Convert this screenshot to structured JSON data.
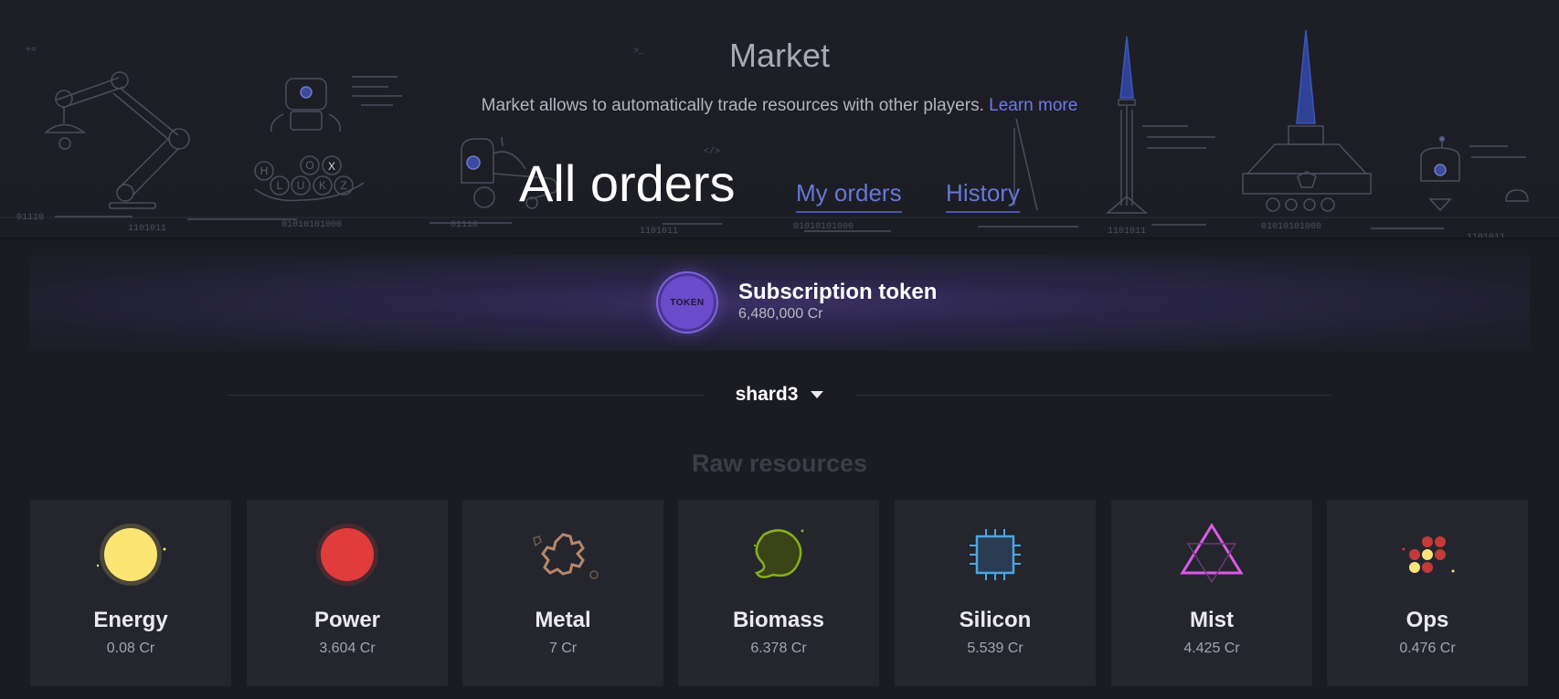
{
  "header": {
    "title": "Market",
    "subtitle": "Market allows to automatically trade resources with other players.",
    "learn_more": "Learn more",
    "tabs": [
      {
        "label": "All orders",
        "active": true
      },
      {
        "label": "My orders",
        "active": false
      },
      {
        "label": "History",
        "active": false
      }
    ],
    "decor_text": {
      "binary_1": "01110",
      "binary_2": "1101011",
      "binary_3": "01010101000",
      "binary_4": "01110",
      "binary_5": "1101011",
      "binary_6": "01010101000",
      "binary_7": "1101011",
      "binary_8": "01010101000",
      "binary_9": "1101011",
      "code_tag": "</>",
      "prompt": ">_",
      "plus_eq": "+=",
      "keys": [
        "H",
        "O",
        "X",
        "L",
        "U",
        "K",
        "Z"
      ]
    }
  },
  "token": {
    "badge": "TOKEN",
    "name": "Subscription token",
    "price": "6,480,000 Cr",
    "color": "#6a4bc9"
  },
  "shard": {
    "selected": "shard3"
  },
  "resources": {
    "title": "Raw resources",
    "items": [
      {
        "name": "Energy",
        "price": "0.08 Cr",
        "icon": "energy-icon",
        "color": "#fde574"
      },
      {
        "name": "Power",
        "price": "3.604 Cr",
        "icon": "power-icon",
        "color": "#e23b3b"
      },
      {
        "name": "Metal",
        "price": "7 Cr",
        "icon": "metal-icon",
        "color": "#b6866a"
      },
      {
        "name": "Biomass",
        "price": "6.378 Cr",
        "icon": "biomass-icon",
        "color": "#86b018"
      },
      {
        "name": "Silicon",
        "price": "5.539 Cr",
        "icon": "silicon-icon",
        "color": "#4da6e1"
      },
      {
        "name": "Mist",
        "price": "4.425 Cr",
        "icon": "mist-icon",
        "color": "#da5ae6"
      },
      {
        "name": "Ops",
        "price": "0.476 Cr",
        "icon": "ops-icon",
        "color": "#f9e37c"
      }
    ]
  }
}
